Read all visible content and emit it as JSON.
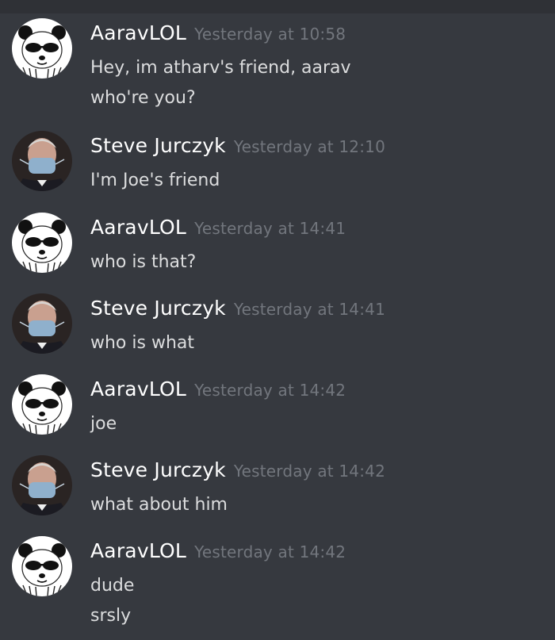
{
  "messages": [
    {
      "author": "AaravLOL",
      "timestamp": "Yesterday at 10:58",
      "avatar": "panda-avatar",
      "lines": [
        "Hey, im atharv's friend, aarav",
        "who're you?"
      ]
    },
    {
      "author": "Steve Jurczyk",
      "timestamp": "Yesterday at 12:10",
      "avatar": "man-mask-avatar",
      "lines": [
        "I'm Joe's friend"
      ]
    },
    {
      "author": "AaravLOL",
      "timestamp": "Yesterday at 14:41",
      "avatar": "panda-avatar",
      "lines": [
        "who is that?"
      ]
    },
    {
      "author": "Steve Jurczyk",
      "timestamp": "Yesterday at 14:41",
      "avatar": "man-mask-avatar",
      "lines": [
        "who is what"
      ]
    },
    {
      "author": "AaravLOL",
      "timestamp": "Yesterday at 14:42",
      "avatar": "panda-avatar",
      "lines": [
        "joe"
      ]
    },
    {
      "author": "Steve Jurczyk",
      "timestamp": "Yesterday at 14:42",
      "avatar": "man-mask-avatar",
      "lines": [
        "what about him"
      ]
    },
    {
      "author": "AaravLOL",
      "timestamp": "Yesterday at 14:42",
      "avatar": "panda-avatar",
      "lines": [
        "dude",
        "srsly"
      ]
    }
  ],
  "colors": {
    "background": "#36393f",
    "author": "#ffffff",
    "timestamp": "#72767d",
    "message_text": "#dcddde"
  }
}
